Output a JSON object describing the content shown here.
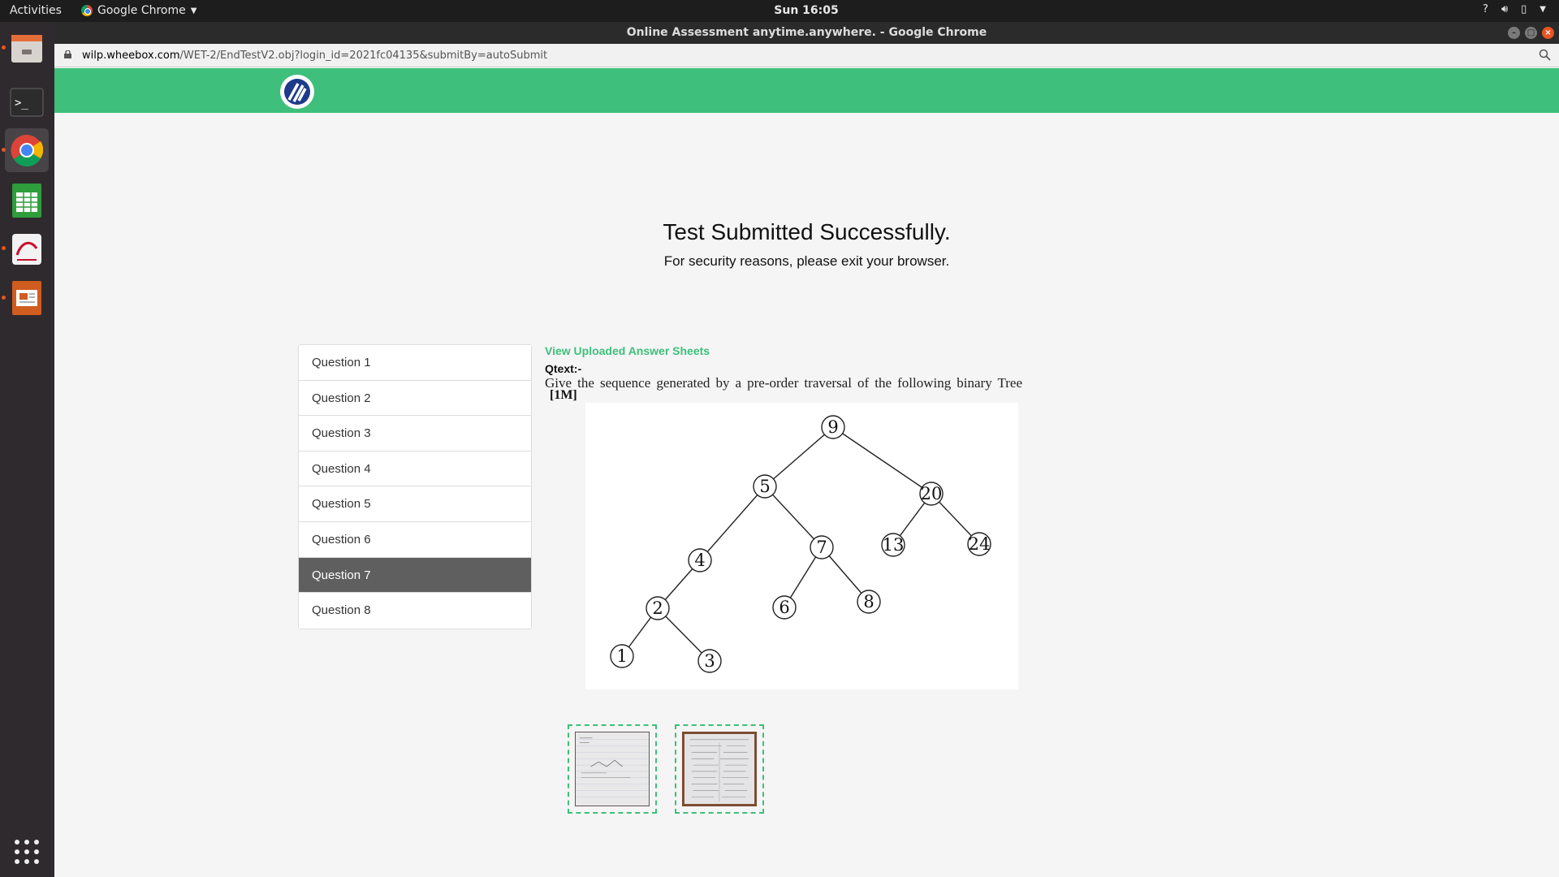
{
  "topbar": {
    "activities": "Activities",
    "app_name": "Google Chrome",
    "clock": "Sun 16:05",
    "tray_help": "?"
  },
  "window": {
    "title": "Online Assessment anytime.anywhere. - Google Chrome"
  },
  "address": {
    "host": "wilp.wheebox.com",
    "path": "/WET-2/EndTestV2.obj?login_id=2021fc04135&submitBy=autoSubmit"
  },
  "page": {
    "success_title": "Test Submitted Successfully.",
    "success_subtitle": "For security reasons, please exit your browser.",
    "questions": [
      {
        "label": "Question 1"
      },
      {
        "label": "Question 2"
      },
      {
        "label": "Question 3"
      },
      {
        "label": "Question 4"
      },
      {
        "label": "Question 5"
      },
      {
        "label": "Question 6"
      },
      {
        "label": "Question 7"
      },
      {
        "label": "Question 8"
      }
    ],
    "selected_question": "Question 7",
    "view_sheets_link": "View Uploaded Answer Sheets",
    "qtext_label": "Qtext:-",
    "question_text": "Give the sequence generated by a pre-order traversal of the following binary Tree",
    "marks": "[1M]",
    "tree_nodes": [
      "9",
      "5",
      "20",
      "4",
      "7",
      "13",
      "24",
      "2",
      "6",
      "8",
      "1",
      "3"
    ]
  },
  "colors": {
    "brand_green": "#3ebf7b",
    "active_item": "#5f5f5f",
    "ubuntu_orange": "#e95420"
  },
  "icons": {
    "dock": [
      "files-icon",
      "terminal-icon",
      "chrome-icon",
      "spreadsheet-icon",
      "pdf-viewer-icon",
      "presentation-icon",
      "app-grid-icon"
    ]
  }
}
